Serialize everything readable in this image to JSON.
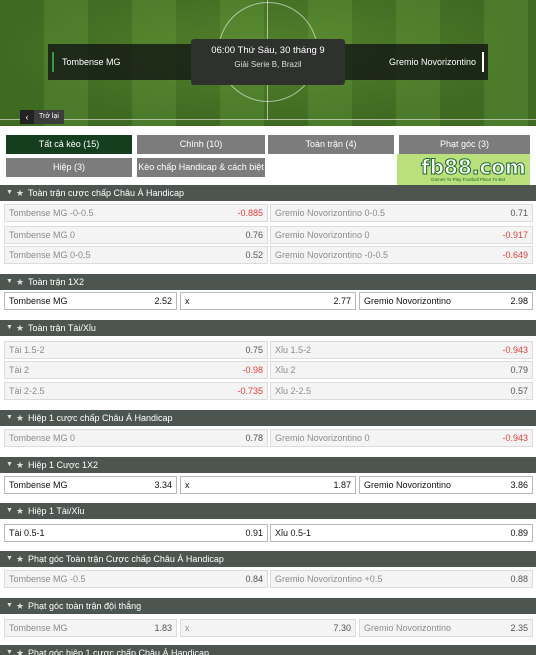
{
  "match": {
    "home": "Tombense MG",
    "away": "Gremio Novorizontino",
    "datetime": "06:00 Thứ Sáu, 30 tháng 9",
    "league": "Giải Serie B, Brazil",
    "back_label": "Trở lại"
  },
  "tabs": [
    {
      "label": "Tất cả kèo (15)",
      "active": true
    },
    {
      "label": "Chính (10)"
    },
    {
      "label": "Toàn trận (4)"
    },
    {
      "label": "Phạt góc (3)"
    },
    {
      "label": "Hiệp (3)"
    },
    {
      "label": "Kèo chấp Handicap & cách biệt (3)"
    }
  ],
  "banner": {
    "logo": "fb88.com",
    "tagline": "Games To Play  Football Place To Bet"
  },
  "sections": [
    {
      "title": "Toàn trận cược chấp Châu Á Handicap",
      "rows": [
        [
          {
            "label": "Tombense MG -0-0.5",
            "odd": "-0.885"
          },
          {
            "label": "Gremio Novorizontino 0-0.5",
            "odd": "0.71"
          }
        ],
        [
          {
            "label": "Tombense MG 0",
            "odd": "0.76"
          },
          {
            "label": "Gremio Novorizontino 0",
            "odd": "-0.917"
          }
        ],
        [
          {
            "label": "Tombense MG 0-0.5",
            "odd": "0.52"
          },
          {
            "label": "Gremio Novorizontino -0-0.5",
            "odd": "-0.649"
          }
        ]
      ]
    },
    {
      "title": "Toàn trận 1X2",
      "rows": [
        [
          {
            "label": "Tombense MG",
            "odd": "2.52"
          },
          {
            "label": "x",
            "odd": "2.77"
          },
          {
            "label": "Gremio Novorizontino",
            "odd": "2.98"
          }
        ]
      ]
    },
    {
      "title": "Toàn trận Tài/Xỉu",
      "rows": [
        [
          {
            "label": "Tài 1.5-2",
            "odd": "0.75"
          },
          {
            "label": "Xỉu 1.5-2",
            "odd": "-0.943"
          }
        ],
        [
          {
            "label": "Tài 2",
            "odd": "-0.98"
          },
          {
            "label": "Xỉu 2",
            "odd": "0.79"
          }
        ],
        [
          {
            "label": "Tài 2-2.5",
            "odd": "-0.735"
          },
          {
            "label": "Xỉu 2-2.5",
            "odd": "0.57"
          }
        ]
      ]
    },
    {
      "title": "Hiệp 1 cược chấp Châu Á Handicap",
      "rows": [
        [
          {
            "label": "Tombense MG 0",
            "odd": "0.78"
          },
          {
            "label": "Gremio Novorizontino 0",
            "odd": "-0.943"
          }
        ]
      ]
    },
    {
      "title": "Hiệp 1 Cược 1X2",
      "rows": [
        [
          {
            "label": "Tombense MG",
            "odd": "3.34"
          },
          {
            "label": "x",
            "odd": "1.87"
          },
          {
            "label": "Gremio Novorizontino",
            "odd": "3.86"
          }
        ]
      ]
    },
    {
      "title": "Hiệp 1 Tài/Xỉu",
      "rows": [
        [
          {
            "label": "Tài 0.5-1",
            "odd": "0.91"
          },
          {
            "label": "Xỉu 0.5-1",
            "odd": "0.89"
          }
        ]
      ]
    },
    {
      "title": "Phạt góc Toàn trận Cược chấp Châu Á Handicap",
      "rows": [
        [
          {
            "label": "Tombense MG -0.5",
            "odd": "0.84"
          },
          {
            "label": "Gremio Novorizontino +0.5",
            "odd": "0.88"
          }
        ]
      ]
    },
    {
      "title": "Phạt góc toàn trận đội thắng",
      "rows": [
        [
          {
            "label": "Tombense MG",
            "odd": "1.83"
          },
          {
            "label": "x",
            "odd": "7.30"
          },
          {
            "label": "Gremio Novorizontino",
            "odd": "2.35"
          }
        ]
      ]
    },
    {
      "title": "Phạt góc hiệp 1 cược chấp Châu Á Handicap",
      "rows": []
    }
  ],
  "icons": {
    "section_toggle": "chevron-down-icon",
    "favorite": "star-icon",
    "back": "chevron-left-icon"
  }
}
